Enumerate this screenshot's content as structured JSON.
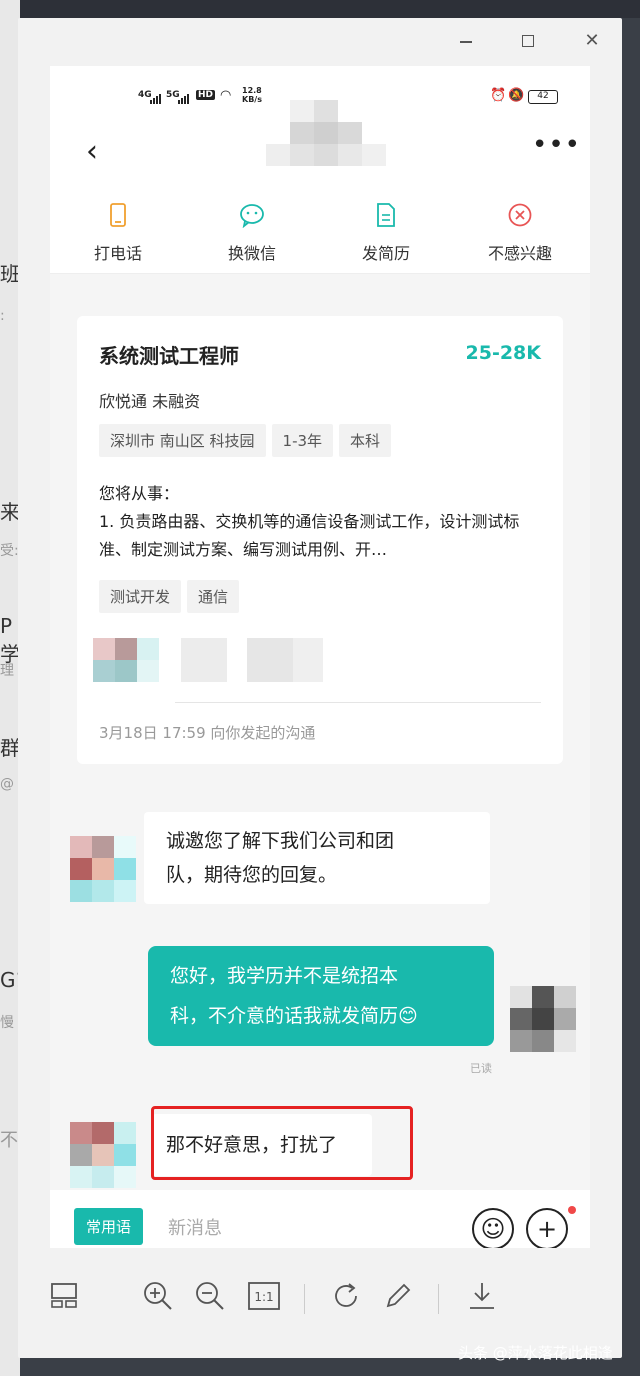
{
  "background_app": {
    "fragments": [
      "班",
      "来",
      "P学",
      "群",
      "G1",
      "不"
    ],
    "small_fragments": [
      ":",
      "受:",
      "理",
      "@",
      "慢"
    ]
  },
  "window": {
    "controls": [
      "minimize",
      "maximize",
      "close"
    ]
  },
  "status_bar": {
    "net1": "4G",
    "net2": "5G",
    "net3": "HD",
    "speed": "12.8 KB/s",
    "battery": "42"
  },
  "header": {
    "actions": [
      {
        "label": "打电话",
        "icon": "phone-icon"
      },
      {
        "label": "换微信",
        "icon": "wechat-icon"
      },
      {
        "label": "发简历",
        "icon": "resume-icon"
      },
      {
        "label": "不感兴趣",
        "icon": "not-interested-icon"
      }
    ]
  },
  "job_card": {
    "title": "系统测试工程师",
    "salary": "25-28K",
    "company": "欣悦通  未融资",
    "tags": [
      "深圳市 南山区 科技园",
      "1-3年",
      "本科"
    ],
    "desc_heading": "您将从事：",
    "desc": "1. 负责路由器、交换机等的通信设备测试工作，设计测试标准、制定测试方案、编写测试用例、开…",
    "skill_tags": [
      "测试开发",
      "通信"
    ],
    "time": "3月18日 17:59 向你发起的沟通"
  },
  "chat": {
    "msg1_line1": "诚邀您了解下我们公司和团",
    "msg1_line2": "队，期待您的回复。",
    "msg2_line1": "您好，我学历并不是统招本",
    "msg2_line2": "科，不介意的话我就发简历😊",
    "read_status": "已读",
    "msg3": "那不好意思，打扰了"
  },
  "input_bar": {
    "quick_phrases": "常用语",
    "placeholder": "新消息"
  },
  "watermark": "头条 @萍水落花此相逢",
  "colors": {
    "accent": "#19b9ac",
    "highlight": "#e52222"
  }
}
